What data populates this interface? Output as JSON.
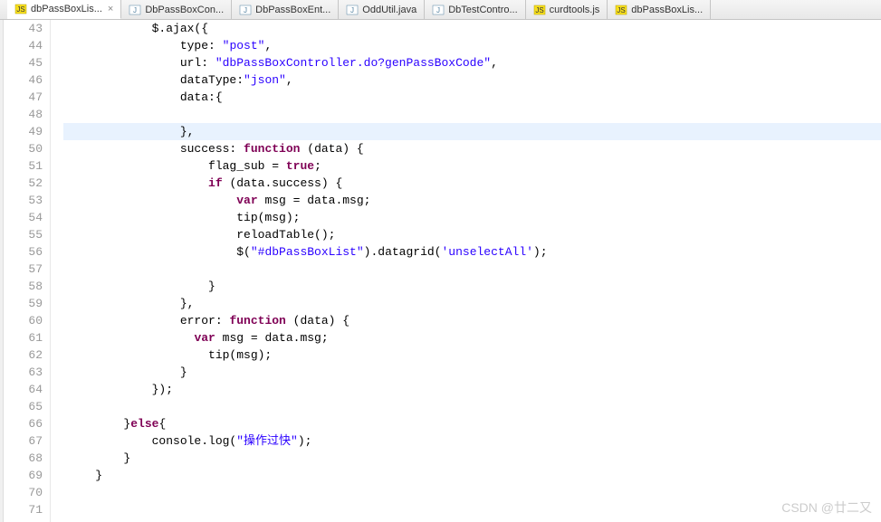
{
  "tabs": [
    {
      "label": "dbPassBoxLis...",
      "icon": "js"
    },
    {
      "label": "DbPassBoxCon...",
      "icon": "java"
    },
    {
      "label": "DbPassBoxEnt...",
      "icon": "java"
    },
    {
      "label": "OddUtil.java",
      "icon": "java"
    },
    {
      "label": "DbTestContro...",
      "icon": "java"
    },
    {
      "label": "curdtools.js",
      "icon": "js"
    },
    {
      "label": "dbPassBoxLis...",
      "icon": "js"
    }
  ],
  "active_tab_index": 0,
  "line_start": 43,
  "line_end": 71,
  "highlighted_line": 49,
  "code": {
    "43": [
      {
        "t": "default",
        "s": "            $.ajax({"
      }
    ],
    "44": [
      {
        "t": "default",
        "s": "                type: "
      },
      {
        "t": "string",
        "s": "\"post\""
      },
      {
        "t": "default",
        "s": ","
      }
    ],
    "45": [
      {
        "t": "default",
        "s": "                url: "
      },
      {
        "t": "string",
        "s": "\"dbPassBoxController.do?genPassBoxCode\""
      },
      {
        "t": "default",
        "s": ","
      }
    ],
    "46": [
      {
        "t": "default",
        "s": "                dataType:"
      },
      {
        "t": "string",
        "s": "\"json\""
      },
      {
        "t": "default",
        "s": ","
      }
    ],
    "47": [
      {
        "t": "default",
        "s": "                data:{"
      }
    ],
    "48": [
      {
        "t": "default",
        "s": ""
      }
    ],
    "49": [
      {
        "t": "default",
        "s": "                },"
      }
    ],
    "50": [
      {
        "t": "default",
        "s": "                success: "
      },
      {
        "t": "keyword",
        "s": "function"
      },
      {
        "t": "default",
        "s": " (data) {"
      }
    ],
    "51": [
      {
        "t": "default",
        "s": "                    flag_sub = "
      },
      {
        "t": "keyword",
        "s": "true"
      },
      {
        "t": "default",
        "s": ";"
      }
    ],
    "52": [
      {
        "t": "default",
        "s": "                    "
      },
      {
        "t": "keyword",
        "s": "if"
      },
      {
        "t": "default",
        "s": " (data.success) {"
      }
    ],
    "53": [
      {
        "t": "default",
        "s": "                        "
      },
      {
        "t": "keyword",
        "s": "var"
      },
      {
        "t": "default",
        "s": " msg = data.msg;"
      }
    ],
    "54": [
      {
        "t": "default",
        "s": "                        tip(msg);"
      }
    ],
    "55": [
      {
        "t": "default",
        "s": "                        reloadTable();"
      }
    ],
    "56": [
      {
        "t": "default",
        "s": "                        $("
      },
      {
        "t": "string",
        "s": "\"#dbPassBoxList\""
      },
      {
        "t": "default",
        "s": ").datagrid("
      },
      {
        "t": "string",
        "s": "'unselectAll'"
      },
      {
        "t": "default",
        "s": ");"
      }
    ],
    "57": [
      {
        "t": "default",
        "s": ""
      }
    ],
    "58": [
      {
        "t": "default",
        "s": "                    }"
      }
    ],
    "59": [
      {
        "t": "default",
        "s": "                },"
      }
    ],
    "60": [
      {
        "t": "default",
        "s": "                error: "
      },
      {
        "t": "keyword",
        "s": "function"
      },
      {
        "t": "default",
        "s": " (data) {"
      }
    ],
    "61": [
      {
        "t": "default",
        "s": "                  "
      },
      {
        "t": "keyword",
        "s": "var"
      },
      {
        "t": "default",
        "s": " msg = data.msg;"
      }
    ],
    "62": [
      {
        "t": "default",
        "s": "                    tip(msg);"
      }
    ],
    "63": [
      {
        "t": "default",
        "s": "                }"
      }
    ],
    "64": [
      {
        "t": "default",
        "s": "            });"
      }
    ],
    "65": [
      {
        "t": "default",
        "s": ""
      }
    ],
    "66": [
      {
        "t": "default",
        "s": "        }"
      },
      {
        "t": "keyword",
        "s": "else"
      },
      {
        "t": "default",
        "s": "{"
      }
    ],
    "67": [
      {
        "t": "default",
        "s": "            console.log("
      },
      {
        "t": "string",
        "s": "\"操作过快\""
      },
      {
        "t": "default",
        "s": ");"
      }
    ],
    "68": [
      {
        "t": "default",
        "s": "        }"
      }
    ],
    "69": [
      {
        "t": "default",
        "s": "    }"
      }
    ],
    "70": [
      {
        "t": "default",
        "s": ""
      }
    ],
    "71": [
      {
        "t": "default",
        "s": ""
      }
    ]
  },
  "watermark": "CSDN @廿二又"
}
